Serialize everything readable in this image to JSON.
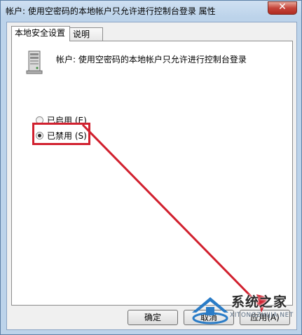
{
  "window": {
    "title": "帐户: 使用空密码的本地帐户只允许进行控制台登录 属性",
    "close_glyph": "✕"
  },
  "tabs": [
    {
      "label": "本地安全设置",
      "active": true
    },
    {
      "label": "说明",
      "active": false
    }
  ],
  "policy": {
    "name": "帐户: 使用空密码的本地帐户只允许进行控制台登录",
    "icon": "server-icon"
  },
  "options": [
    {
      "label": "已启用 (E)",
      "selected": false
    },
    {
      "label": "已禁用 (S)",
      "selected": true
    }
  ],
  "buttons": {
    "ok": "确定",
    "cancel": "取消",
    "apply": "应用(A)"
  },
  "watermark": {
    "text": "系统之家",
    "sub": "XITONGZHIJIA.NET"
  },
  "colors": {
    "annotation": "#d1202e"
  }
}
